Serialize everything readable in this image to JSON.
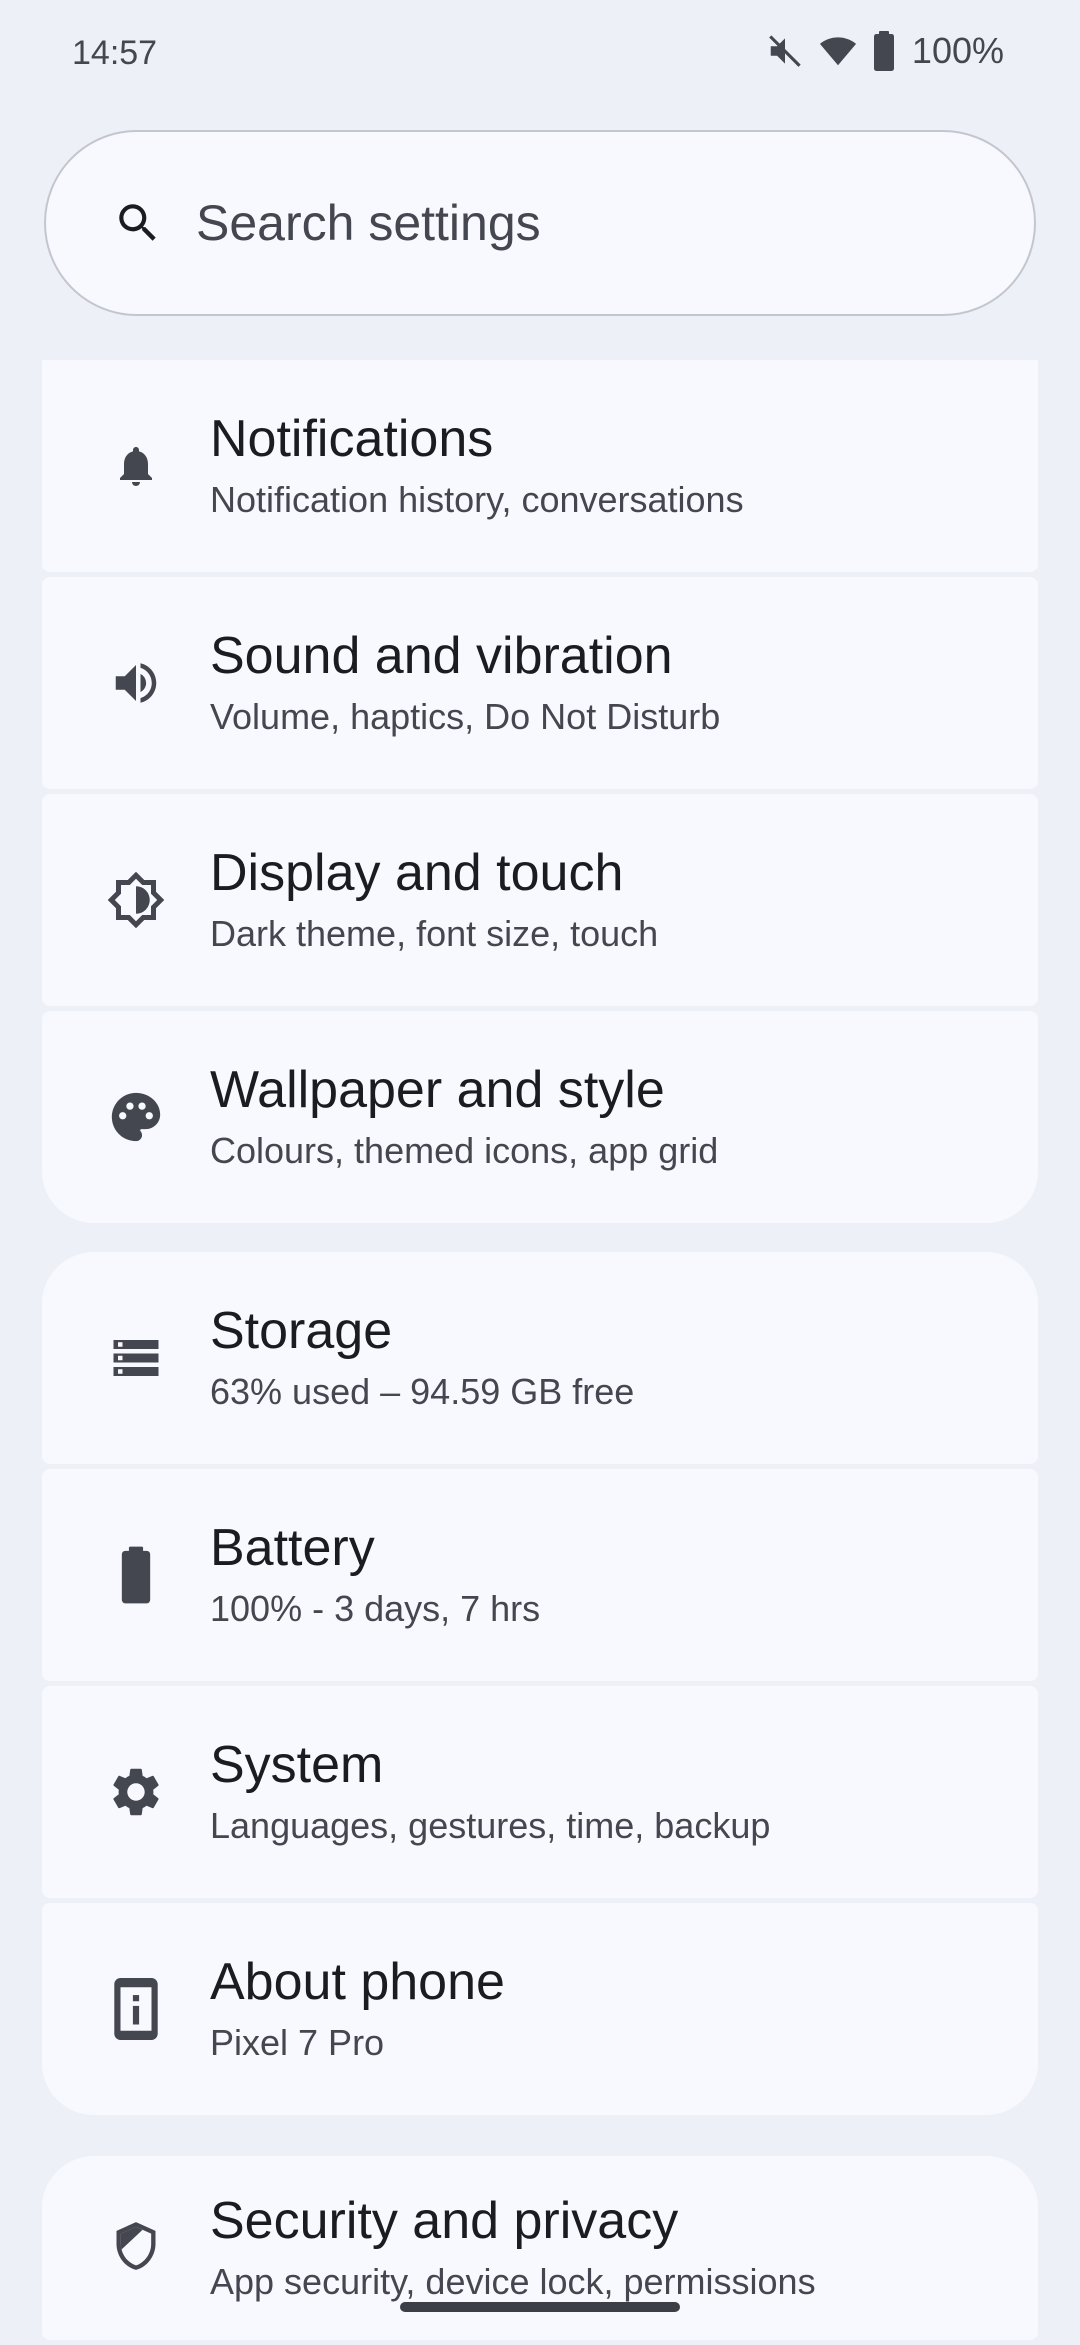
{
  "status_bar": {
    "time": "14:57",
    "icons": [
      "mute-vibrate-off-icon",
      "wifi-icon",
      "battery-icon"
    ],
    "battery_percent": "100%"
  },
  "search": {
    "placeholder": "Search settings",
    "icon": "search-icon"
  },
  "colors": {
    "background": "#edf0f6",
    "card": "#f8f9ff",
    "title": "#1b1c20",
    "subtitle": "#44474f",
    "icon": "#444750"
  },
  "groups": [
    {
      "items": [
        {
          "icon": "bell-icon",
          "title": "Notifications",
          "subtitle": "Notification history, conversations"
        },
        {
          "icon": "volume-icon",
          "title": "Sound and vibration",
          "subtitle": "Volume, haptics, Do Not Disturb"
        },
        {
          "icon": "brightness-icon",
          "title": "Display and touch",
          "subtitle": "Dark theme, font size, touch"
        },
        {
          "icon": "palette-icon",
          "title": "Wallpaper and style",
          "subtitle": "Colours, themed icons, app grid"
        }
      ]
    },
    {
      "items": [
        {
          "icon": "storage-icon",
          "title": "Storage",
          "subtitle": "63% used – 94.59 GB free"
        },
        {
          "icon": "battery-icon",
          "title": "Battery",
          "subtitle": "100% - 3 days, 7 hrs"
        },
        {
          "icon": "gear-icon",
          "title": "System",
          "subtitle": "Languages, gestures, time, backup"
        },
        {
          "icon": "phone-info-icon",
          "title": "About phone",
          "subtitle": "Pixel 7 Pro"
        }
      ]
    },
    {
      "items": [
        {
          "icon": "shield-icon",
          "title": "Security and privacy",
          "subtitle": "App security, device lock, permissions"
        }
      ]
    }
  ]
}
